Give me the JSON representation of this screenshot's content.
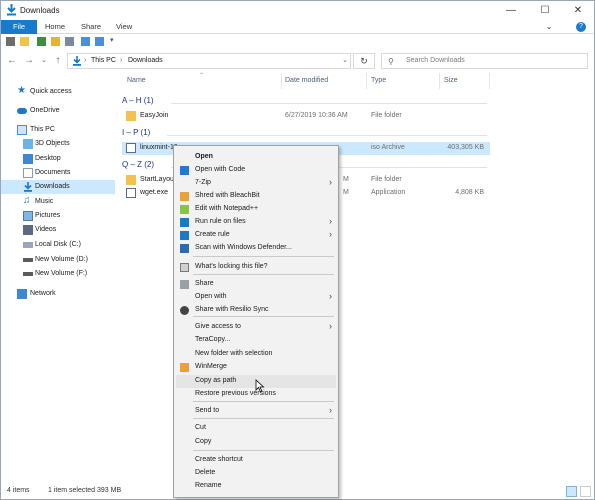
{
  "window": {
    "title": "Downloads"
  },
  "ribbon": {
    "tabs": [
      "File",
      "Home",
      "Share",
      "View"
    ]
  },
  "address": {
    "crumbs": [
      "This PC",
      "Downloads"
    ],
    "search_placeholder": "Search Downloads"
  },
  "nav": {
    "items": [
      {
        "label": "Quick access",
        "icon": "star-icon"
      },
      {
        "label": "OneDrive",
        "icon": "cloud-icon"
      },
      {
        "label": "This PC",
        "icon": "computer-icon"
      },
      {
        "label": "3D Objects",
        "icon": "cube-icon"
      },
      {
        "label": "Desktop",
        "icon": "desktop-icon"
      },
      {
        "label": "Documents",
        "icon": "document-icon"
      },
      {
        "label": "Downloads",
        "icon": "download-icon"
      },
      {
        "label": "Music",
        "icon": "music-icon"
      },
      {
        "label": "Pictures",
        "icon": "picture-icon"
      },
      {
        "label": "Videos",
        "icon": "video-icon"
      },
      {
        "label": "Local Disk (C:)",
        "icon": "disk-icon"
      },
      {
        "label": "New Volume (D:)",
        "icon": "drive-icon"
      },
      {
        "label": "New Volume (F:)",
        "icon": "drive-icon"
      },
      {
        "label": "Network",
        "icon": "network-icon"
      }
    ]
  },
  "columns": {
    "name": "Name",
    "date": "Date modified",
    "type": "Type",
    "size": "Size"
  },
  "groups": [
    {
      "label": "A – H (1)"
    },
    {
      "label": "I – P (1)"
    },
    {
      "label": "Q – Z (2)"
    }
  ],
  "files": [
    {
      "name": "EasyJoin",
      "date": "6/27/2019 10:36 AM",
      "type": "File folder",
      "size": ""
    },
    {
      "name": "linuxmint-19",
      "date": "",
      "type": "iso Archive",
      "size": "403,305 KB"
    },
    {
      "name": "StartLayout",
      "date": "M",
      "type": "File folder",
      "size": ""
    },
    {
      "name": "wget.exe",
      "date": "M",
      "type": "Application",
      "size": "4,808 KB"
    }
  ],
  "status": {
    "count": "4 items",
    "selection": "1 item selected  393 MB"
  },
  "context_menu": {
    "items": [
      {
        "label": "Open",
        "bold": true,
        "icon": "",
        "arrow": false
      },
      {
        "label": "Open with Code",
        "icon": "vscode-icon",
        "arrow": false
      },
      {
        "label": "7-Zip",
        "icon": "",
        "arrow": true
      },
      {
        "label": "Shred with BleachBit",
        "icon": "bleachbit-icon",
        "arrow": false
      },
      {
        "label": "Edit with Notepad++",
        "icon": "notepadpp-icon",
        "arrow": false
      },
      {
        "label": "Run rule on files",
        "icon": "rule-icon",
        "arrow": true
      },
      {
        "label": "Create rule",
        "icon": "rule-icon",
        "arrow": true
      },
      {
        "label": "Scan with Windows Defender...",
        "icon": "defender-icon",
        "arrow": false
      },
      {
        "label": "What's locking this file?",
        "icon": "lock-search-icon",
        "arrow": false
      },
      {
        "label": "Share",
        "icon": "share-icon",
        "arrow": false
      },
      {
        "label": "Open with",
        "icon": "",
        "arrow": true
      },
      {
        "label": "Share with Resilio Sync",
        "icon": "resilio-icon",
        "arrow": false
      },
      {
        "label": "Give access to",
        "icon": "",
        "arrow": true
      },
      {
        "label": "TeraCopy...",
        "icon": "",
        "arrow": false
      },
      {
        "label": "New folder with selection",
        "icon": "",
        "arrow": false
      },
      {
        "label": "WinMerge",
        "icon": "winmerge-icon",
        "arrow": false
      },
      {
        "label": "Copy as path",
        "icon": "",
        "arrow": false
      },
      {
        "label": "Restore previous versions",
        "icon": "",
        "arrow": false
      },
      {
        "label": "Send to",
        "icon": "",
        "arrow": true
      },
      {
        "label": "Cut",
        "icon": "",
        "arrow": false
      },
      {
        "label": "Copy",
        "icon": "",
        "arrow": false
      },
      {
        "label": "Create shortcut",
        "icon": "",
        "arrow": false
      },
      {
        "label": "Delete",
        "icon": "",
        "arrow": false
      },
      {
        "label": "Rename",
        "icon": "",
        "arrow": false
      }
    ]
  },
  "colors": {
    "accent": "#1979ca",
    "selection": "#cce8ff",
    "group": "#1e3287"
  }
}
